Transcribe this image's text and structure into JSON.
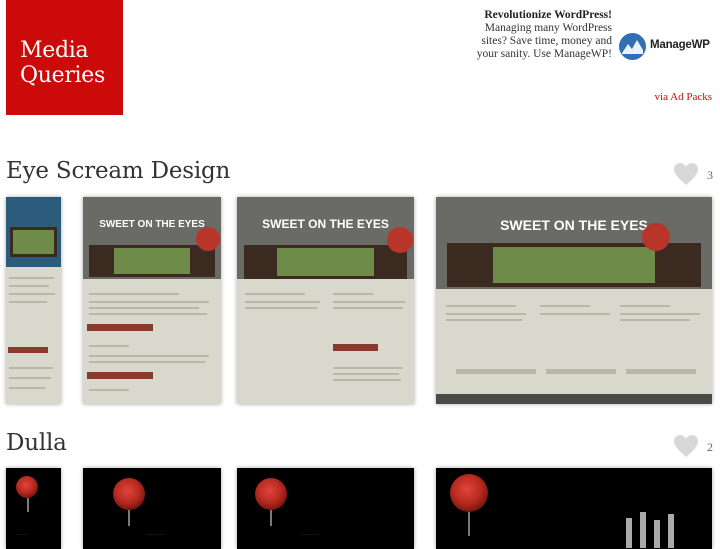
{
  "logo": {
    "line1": "Media",
    "line2": "Queries"
  },
  "ad": {
    "headline": "Revolutionize WordPress!",
    "body": "Managing many WordPress sites? Save time, money and your sanity. Use ManageWP!",
    "brand": "ManageWP",
    "via": "via Ad Packs"
  },
  "sections": [
    {
      "title": "Eye Scream Design",
      "likes": "3",
      "hero": "SWEET ON THE EYES"
    },
    {
      "title": "Dulla",
      "likes": "2"
    }
  ],
  "colors": {
    "brand_red": "#cc0a0a",
    "like_grey": "#d8d8d8"
  }
}
